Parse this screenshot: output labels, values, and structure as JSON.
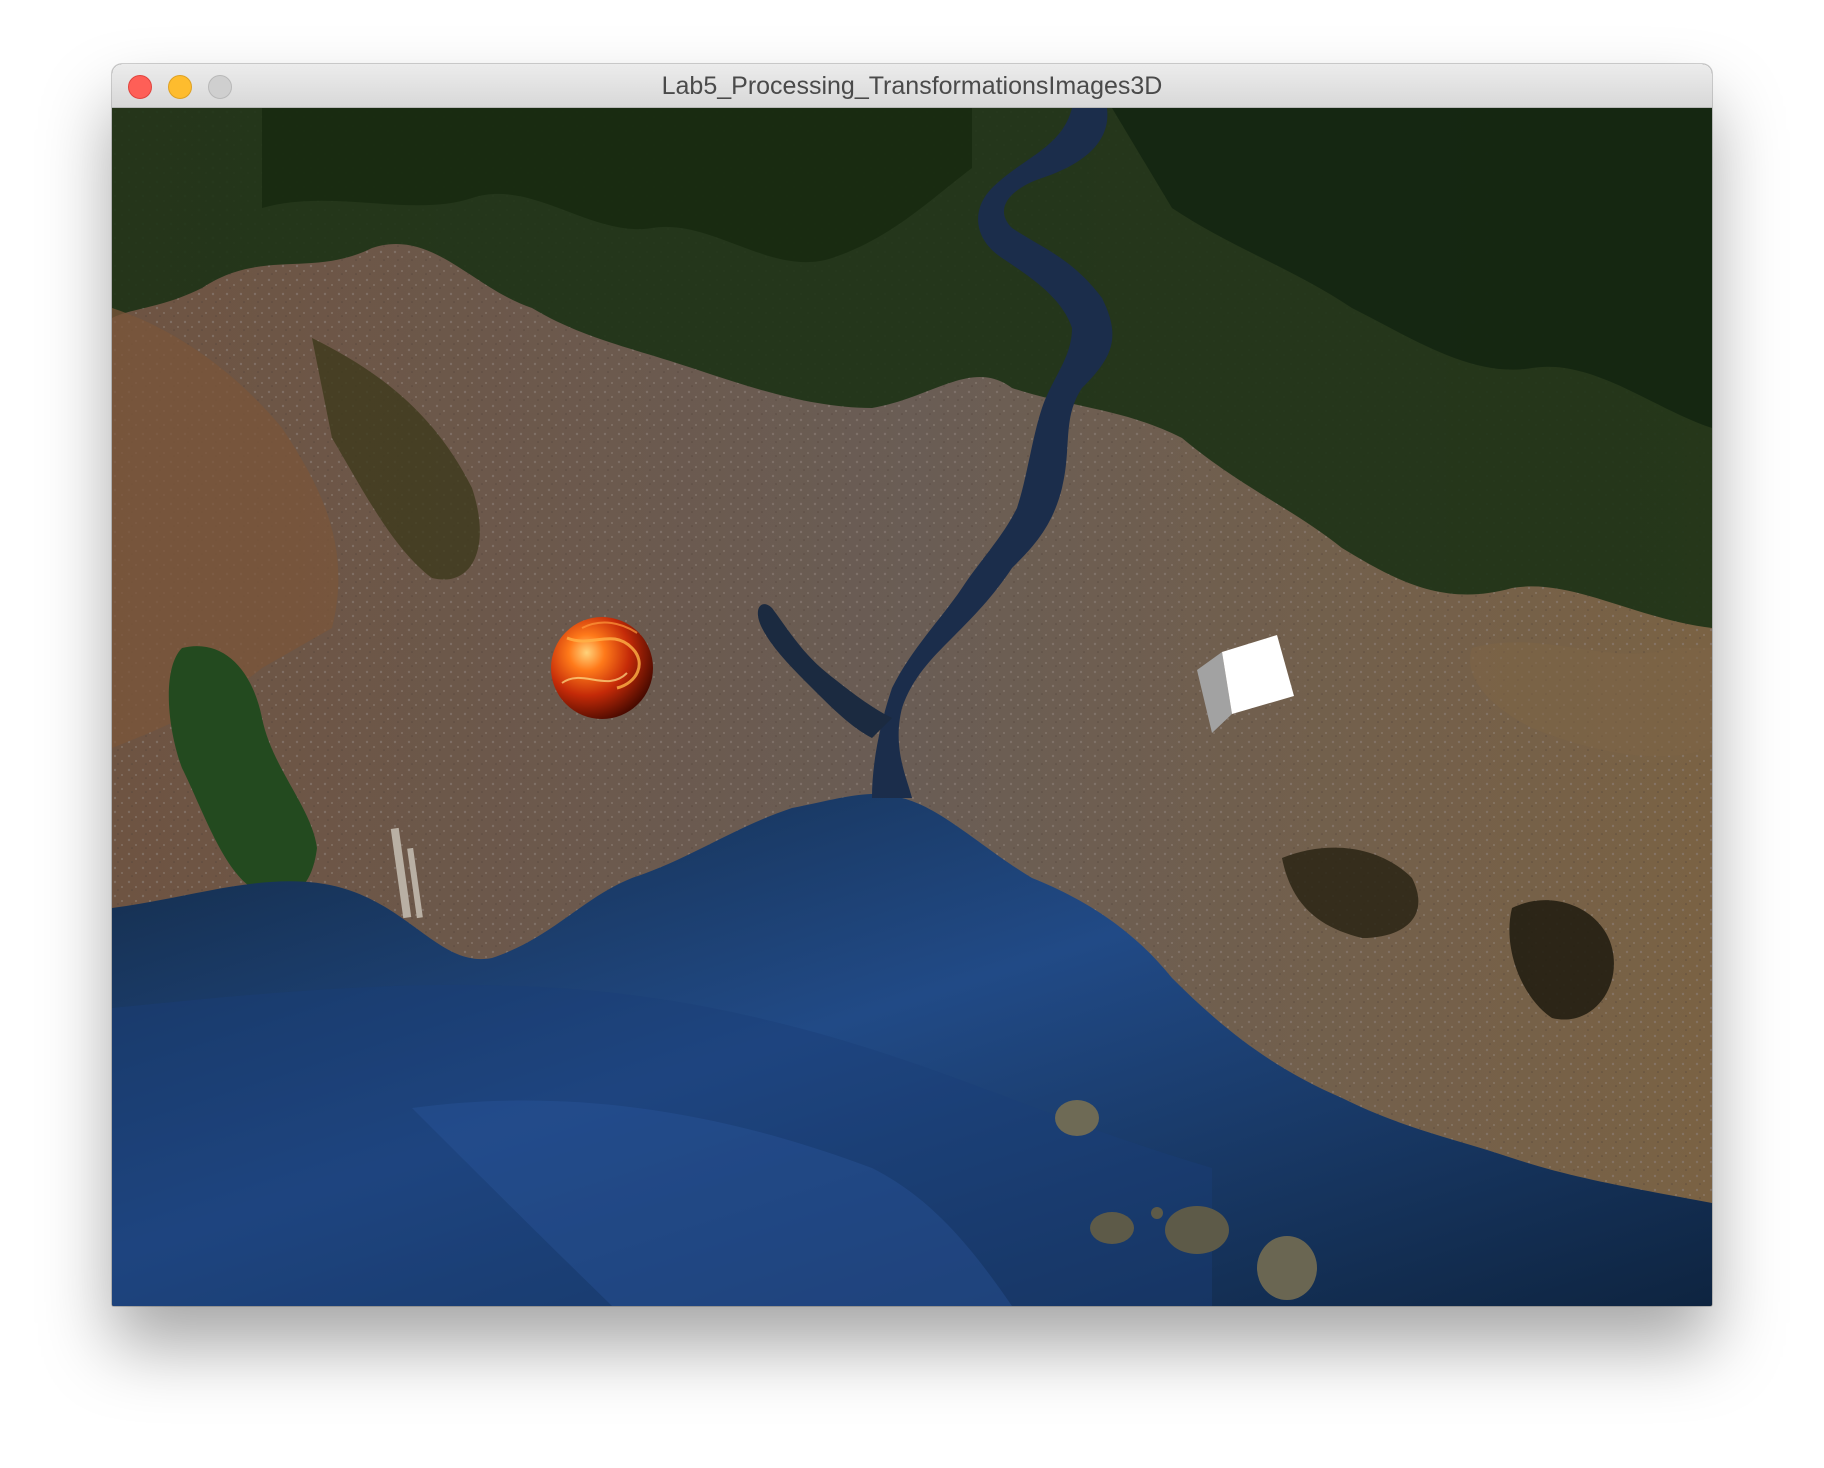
{
  "window": {
    "title": "Lab5_Processing_TransformationsImages3D",
    "controls": {
      "close": "close-button",
      "minimize": "minimize-button",
      "zoom": "zoom-button"
    }
  },
  "sketch": {
    "background": "satellite image of Istanbul (Bosphorus strait, Sea of Marmara, Princes' Islands)",
    "objects": [
      {
        "name": "textured-sphere",
        "texture": "fiery orange-red"
      },
      {
        "name": "white-box",
        "color": "#ffffff"
      }
    ]
  },
  "colors": {
    "close": "#fe5f57",
    "minimize": "#febc2e",
    "zoom": "#cfcfcf",
    "land": "#6b5a4a",
    "forest": "#1f3518",
    "water": "#17304d",
    "sea": "#1d3f6e"
  }
}
